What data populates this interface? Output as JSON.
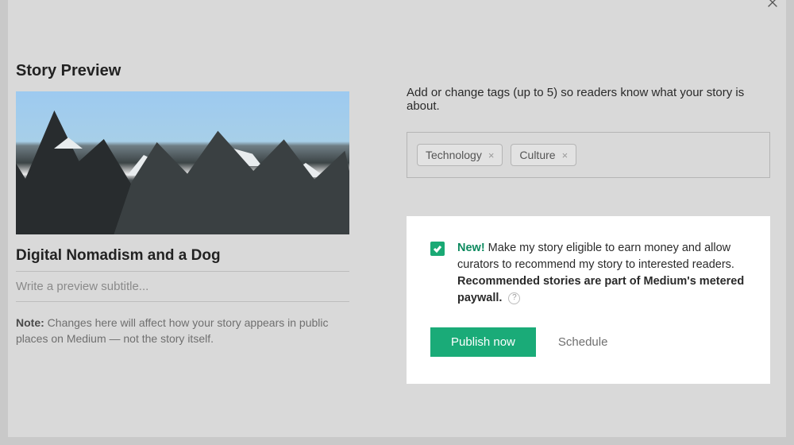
{
  "header": {
    "close_label": "Close"
  },
  "preview": {
    "section_title": "Story Preview",
    "story_title": "Digital Nomadism and a Dog",
    "subtitle_placeholder": "Write a preview subtitle...",
    "note_bold": "Note:",
    "note_text": " Changes here will affect how your story appears in public places on Medium — not the story itself.",
    "image_alt": "mountain-landscape"
  },
  "tags": {
    "help_text": "Add or change tags (up to 5) so readers know what your story is about.",
    "items": [
      {
        "label": "Technology"
      },
      {
        "label": "Culture"
      }
    ]
  },
  "eligibility": {
    "checked": true,
    "new_badge": "New!",
    "body_text": " Make my story eligible to earn money and allow curators to recommend my story to interested readers. ",
    "bold_tail": "Recommended stories are part of Medium's metered paywall.",
    "help_glyph": "?"
  },
  "actions": {
    "publish_label": "Publish now",
    "schedule_label": "Schedule"
  },
  "colors": {
    "accent": "#1aab78",
    "panel_bg": "#d9d9d9",
    "card_bg": "#ffffff"
  }
}
